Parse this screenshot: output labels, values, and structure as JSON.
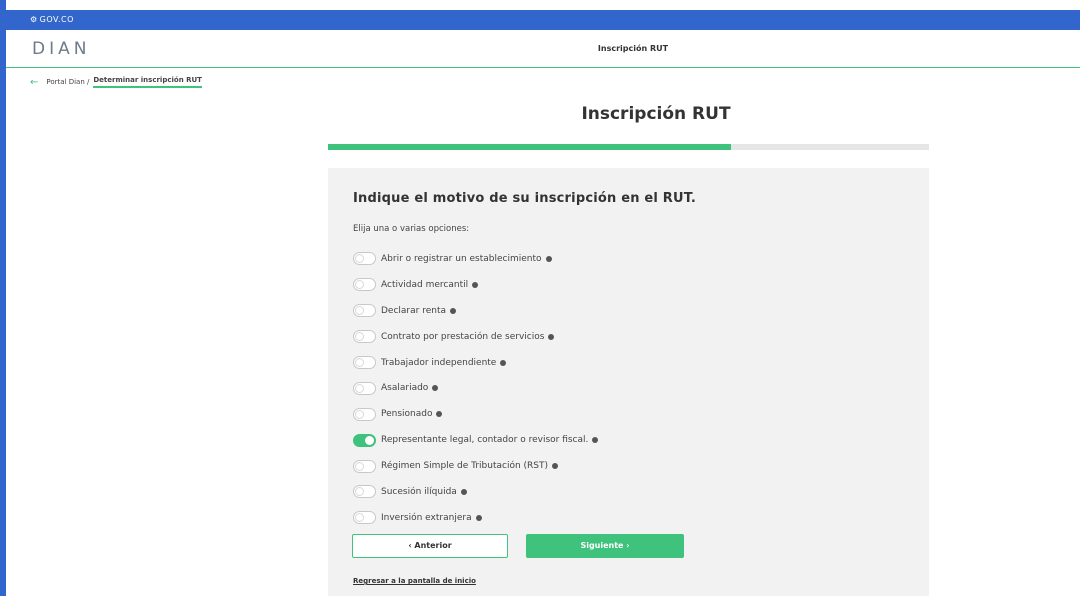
{
  "gov_bar": {
    "icon": "gov-co-icon",
    "label": "GOV.CO"
  },
  "header": {
    "logo": "DIAN",
    "title": "Inscripción RUT"
  },
  "breadcrumb": {
    "parent": "Portal Dian /",
    "current": "Determinar inscripción RUT"
  },
  "page": {
    "title": "Inscripción RUT",
    "progress": 0.67
  },
  "form": {
    "question": "Indique el motivo de su inscripción en el RUT.",
    "hint": "Elija una o varias opciones:",
    "options": [
      {
        "label": "Abrir o registrar un establecimiento",
        "checked": false
      },
      {
        "label": "Actividad mercantil",
        "checked": false
      },
      {
        "label": "Declarar renta",
        "checked": false
      },
      {
        "label": "Contrato por prestación de servicios",
        "checked": false
      },
      {
        "label": "Trabajador independiente",
        "checked": false
      },
      {
        "label": "Asalariado",
        "checked": false
      },
      {
        "label": "Pensionado",
        "checked": false
      },
      {
        "label": "Representante legal, contador o revisor fiscal.",
        "checked": true
      },
      {
        "label": "Régimen Simple de Tributación (RST)",
        "checked": false
      },
      {
        "label": "Sucesión ilíquida",
        "checked": false
      },
      {
        "label": "Inversión extranjera",
        "checked": false
      }
    ],
    "prev_label": "‹  Anterior",
    "next_label": "Siguiente  ›",
    "home_link": "Regresar a la pantalla de inicio"
  },
  "colors": {
    "accent": "#3ec27c",
    "gov_blue": "#3366cc"
  }
}
